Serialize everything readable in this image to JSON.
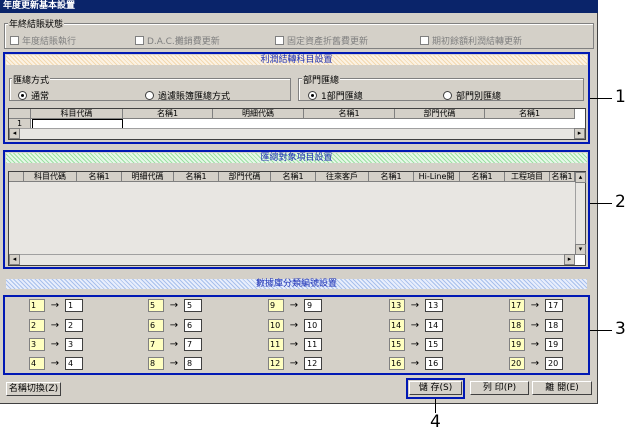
{
  "window": {
    "title": "年度更新基本設置"
  },
  "year_end": {
    "title": "年終結賬狀態",
    "checks": [
      {
        "label": "年度結賬執行"
      },
      {
        "label": "D.A.C.攤銷費更新"
      },
      {
        "label": "固定資產折舊費更新"
      },
      {
        "label": "期初餘額利潤結轉更新"
      }
    ]
  },
  "section1": {
    "banner": "利潤結轉科目設置",
    "method": {
      "title": "匯總方式",
      "options": [
        {
          "label": "通常",
          "selected": true
        },
        {
          "label": "過濾賬簿匯總方式",
          "selected": false
        }
      ]
    },
    "dept": {
      "title": "部門匯總",
      "options": [
        {
          "label": "1部門匯總",
          "selected": true
        },
        {
          "label": "部門別匯總",
          "selected": false
        }
      ]
    },
    "columns": [
      "",
      "科目代碼",
      "名稱1",
      "明細代碼",
      "名稱1",
      "部門代碼",
      "名稱1"
    ],
    "row_num": "1"
  },
  "section2": {
    "banner": "匯總對象項目設置",
    "columns": [
      "",
      "科目代碼",
      "名稱1",
      "明細代碼",
      "名稱1",
      "部門代碼",
      "名稱1",
      "往來客戶",
      "名稱1",
      "Hi-Line開",
      "名稱1",
      "工程項目",
      "名稱1"
    ]
  },
  "section3": {
    "banner": "數據庫分類編號設置",
    "pairs": [
      {
        "src": "1",
        "dst": "1"
      },
      {
        "src": "5",
        "dst": "5"
      },
      {
        "src": "9",
        "dst": "9"
      },
      {
        "src": "13",
        "dst": "13"
      },
      {
        "src": "17",
        "dst": "17"
      },
      {
        "src": "2",
        "dst": "2"
      },
      {
        "src": "6",
        "dst": "6"
      },
      {
        "src": "10",
        "dst": "10"
      },
      {
        "src": "14",
        "dst": "14"
      },
      {
        "src": "18",
        "dst": "18"
      },
      {
        "src": "3",
        "dst": "3"
      },
      {
        "src": "7",
        "dst": "7"
      },
      {
        "src": "11",
        "dst": "11"
      },
      {
        "src": "15",
        "dst": "15"
      },
      {
        "src": "19",
        "dst": "19"
      },
      {
        "src": "4",
        "dst": "4"
      },
      {
        "src": "8",
        "dst": "8"
      },
      {
        "src": "12",
        "dst": "12"
      },
      {
        "src": "16",
        "dst": "16"
      },
      {
        "src": "20",
        "dst": "20"
      }
    ],
    "arrow": "→"
  },
  "buttons": {
    "switch_name": "名稱切換(Z)",
    "save": "儲 存(S)",
    "print": "列 印(P)",
    "close": "離 開(E)"
  },
  "callouts": [
    "1",
    "2",
    "3",
    "4"
  ],
  "colors": {
    "frame": "#0018b4",
    "title_bar": "#0a246a",
    "source_field": "#ffffc0"
  }
}
